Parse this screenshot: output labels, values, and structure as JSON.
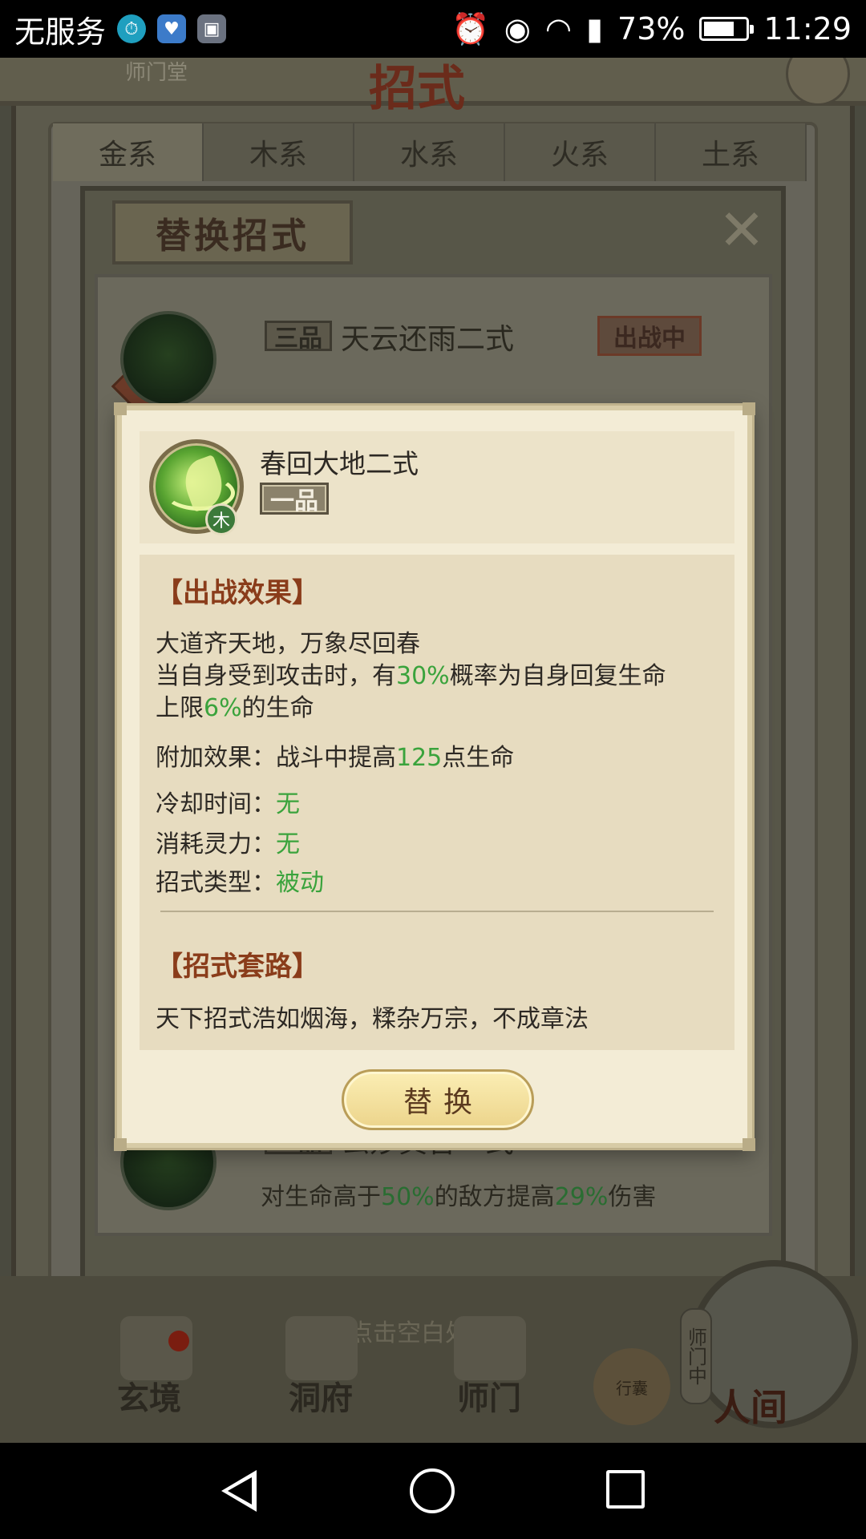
{
  "status_bar": {
    "carrier": "无服务",
    "battery_percent": "73%",
    "battery_level": 0.73,
    "time": "11:29"
  },
  "background": {
    "title": "招式",
    "subtitle": "师门堂",
    "tabs": [
      "金系",
      "木系",
      "水系",
      "火系",
      "土系"
    ],
    "active_tab": 0,
    "sub_dialog_title": "替换招式",
    "rank_flag": "一",
    "skill_rows": [
      {
        "grade": "三品",
        "name": "天云还雨二式",
        "tag": "出战中",
        "desc_parts": []
      },
      {
        "grade": "一品",
        "name": "玄妙真言一式",
        "tag": "",
        "desc_parts": [
          "对生命高于",
          "50%",
          "的敌方提高",
          "29%",
          "伤害"
        ]
      }
    ],
    "tap_hint": "点击空白处返回",
    "nav": {
      "xuanjing": "玄境",
      "dongfu": "洞府",
      "shimen": "师门",
      "bag": "行囊",
      "renjian": "人间",
      "shimen_tag": "师门中"
    }
  },
  "popup": {
    "skill_name": "春回大地二式",
    "grade": "一品",
    "element": "木",
    "effect_title": "【出战效果】",
    "effect_line1": "大道齐天地，万象尽回春",
    "effect_line2": {
      "a": "当自身受到攻击时，有",
      "b": "30%",
      "c": "概率为自身回复生命"
    },
    "effect_line3": {
      "a": "上限",
      "b": "6%",
      "c": "的生命"
    },
    "bonus": {
      "a": "附加效果：战斗中提高",
      "b": "125",
      "c": "点生命"
    },
    "cooldown": {
      "label": "冷却时间：",
      "value": "无"
    },
    "cost": {
      "label": "消耗灵力：",
      "value": "无"
    },
    "type": {
      "label": "招式类型：",
      "value": "被动"
    },
    "routine_title": "【招式套路】",
    "routine_text": "天下招式浩如烟海，糅杂万宗，不成章法",
    "button_label": "替换"
  },
  "colors": {
    "highlight_green": "#3aa33c",
    "section_title": "#8a3c1a",
    "popup_bg": "#f3ecd6"
  }
}
